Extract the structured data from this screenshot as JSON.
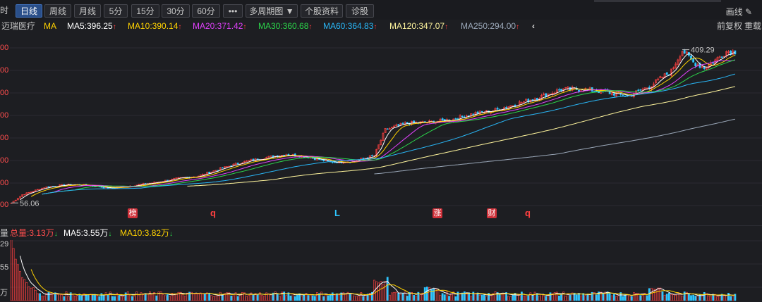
{
  "toolbar": {
    "tabs": [
      {
        "label": "时",
        "active": false
      },
      {
        "label": "日线",
        "active": true
      },
      {
        "label": "周线",
        "active": false
      },
      {
        "label": "月线",
        "active": false
      },
      {
        "label": "5分",
        "active": false
      },
      {
        "label": "15分",
        "active": false
      },
      {
        "label": "30分",
        "active": false
      },
      {
        "label": "60分",
        "active": false
      },
      {
        "label": "•••",
        "active": false
      },
      {
        "label": "多周期图 ▼",
        "active": false
      },
      {
        "label": "个股资料",
        "active": false
      },
      {
        "label": "诊股",
        "active": false
      }
    ],
    "draw_label": "画线",
    "draw_icon": "pencil-icon"
  },
  "ma_legend": {
    "stock_name": "迈瑞医疗",
    "ma_label": "MA",
    "items": [
      {
        "text": "MA5:396.25",
        "color": "#ffffff"
      },
      {
        "text": "MA10:390.14",
        "color": "#ffd200"
      },
      {
        "text": "MA20:371.42",
        "color": "#e040fb"
      },
      {
        "text": "MA30:360.68",
        "color": "#2bd44a"
      },
      {
        "text": "MA60:364.83",
        "color": "#29b6f6"
      },
      {
        "text": "MA120:347.07",
        "color": "#fff59d"
      },
      {
        "text": "MA250:294.00",
        "color": "#9aa7b8"
      }
    ],
    "collapse_icon": "chevron-left-icon",
    "adjust_label": "前复权",
    "overlay_label": "重载"
  },
  "volume_legend": {
    "label": "量",
    "total": "总量:3.13万",
    "ma5": "MA5:3.55万",
    "ma10": "MA10:3.82万"
  },
  "price_axis_labels": [
    "00",
    "00",
    "00",
    "00",
    "00",
    "00",
    "00",
    "00"
  ],
  "volume_axis_labels": [
    "29",
    "55",
    "万"
  ],
  "event_markers": [
    {
      "text": "榜",
      "style": "box"
    },
    {
      "text": "q",
      "style": "letter"
    },
    {
      "text": "L",
      "style": "cyan"
    },
    {
      "text": "涨",
      "style": "box"
    },
    {
      "text": "财",
      "style": "box"
    },
    {
      "text": "q",
      "style": "letter"
    }
  ],
  "chart_data": {
    "type": "line",
    "subtype": "candlestick",
    "price_range": [
      50,
      420
    ],
    "annotations": {
      "high": "409.29",
      "low": "56.06"
    },
    "colors": {
      "up": "#ff4040",
      "down": "#2ec6ff"
    },
    "price_path": [
      [
        0,
        56
      ],
      [
        5,
        75
      ],
      [
        15,
        92
      ],
      [
        25,
        98
      ],
      [
        35,
        97
      ],
      [
        45,
        90
      ],
      [
        55,
        96
      ],
      [
        65,
        103
      ],
      [
        75,
        112
      ],
      [
        85,
        118
      ],
      [
        95,
        135
      ],
      [
        105,
        150
      ],
      [
        115,
        160
      ],
      [
        125,
        168
      ],
      [
        135,
        162
      ],
      [
        145,
        150
      ],
      [
        155,
        152
      ],
      [
        165,
        165
      ],
      [
        170,
        225
      ],
      [
        180,
        240
      ],
      [
        190,
        242
      ],
      [
        200,
        248
      ],
      [
        210,
        262
      ],
      [
        220,
        270
      ],
      [
        230,
        285
      ],
      [
        240,
        300
      ],
      [
        250,
        318
      ],
      [
        260,
        318
      ],
      [
        270,
        312
      ],
      [
        280,
        302
      ],
      [
        290,
        325
      ],
      [
        300,
        360
      ],
      [
        305,
        409
      ],
      [
        310,
        380
      ],
      [
        315,
        368
      ],
      [
        320,
        385
      ],
      [
        325,
        405
      ]
    ],
    "series": [
      {
        "name": "MA5",
        "color": "#ffffff",
        "last": 396.25
      },
      {
        "name": "MA10",
        "color": "#ffd200",
        "last": 390.14
      },
      {
        "name": "MA20",
        "color": "#e040fb",
        "last": 371.42
      },
      {
        "name": "MA30",
        "color": "#2bd44a",
        "last": 360.68
      },
      {
        "name": "MA60",
        "color": "#29b6f6",
        "last": 364.83
      },
      {
        "name": "MA120",
        "color": "#fff59d",
        "last": 347.07
      },
      {
        "name": "MA250",
        "color": "#9aa7b8",
        "last": 294.0
      }
    ],
    "volume": {
      "max": 29,
      "ma5_last": 3.55,
      "ma10_last": 3.82,
      "total_last": 3.13
    }
  }
}
